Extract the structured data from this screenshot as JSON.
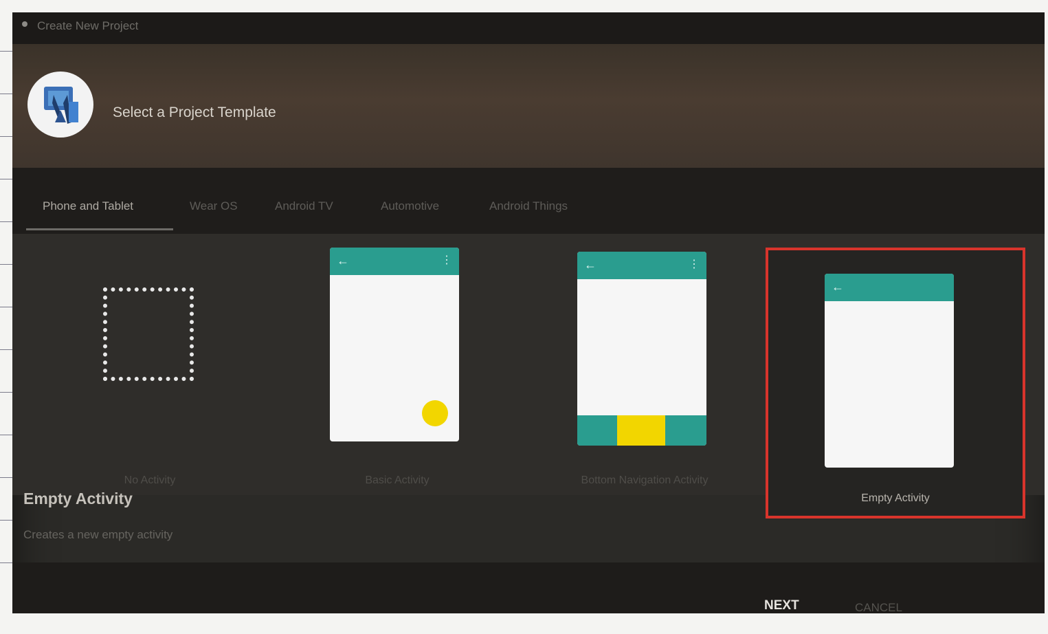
{
  "window": {
    "title": "Create New Project"
  },
  "header": {
    "title": "Select a Project Template",
    "logo_icon": "android-studio-logo"
  },
  "tabs": [
    {
      "label": "Phone and Tablet",
      "active": true
    },
    {
      "label": "Wear OS",
      "active": false
    },
    {
      "label": "Android TV",
      "active": false
    },
    {
      "label": "Automotive",
      "active": false
    },
    {
      "label": "Android Things",
      "active": false
    }
  ],
  "templates": [
    {
      "label": "No Activity",
      "preview": "dotted-box",
      "selected": false
    },
    {
      "label": "Basic Activity",
      "preview": "phone-with-fab",
      "selected": false
    },
    {
      "label": "Bottom Navigation Activity",
      "preview": "phone-with-bottom-nav",
      "selected": false
    },
    {
      "label": "Empty Activity",
      "preview": "empty-phone",
      "selected": true
    }
  ],
  "description": {
    "title": "Empty Activity",
    "body": "Creates a new empty activity"
  },
  "footer": {
    "next_label": "NEXT",
    "cancel_label": "CANCEL"
  },
  "colors": {
    "appbar": "#2a9d8f",
    "fab": "#f2d600",
    "selection": "#d8342c",
    "background": "#2b2a27"
  }
}
